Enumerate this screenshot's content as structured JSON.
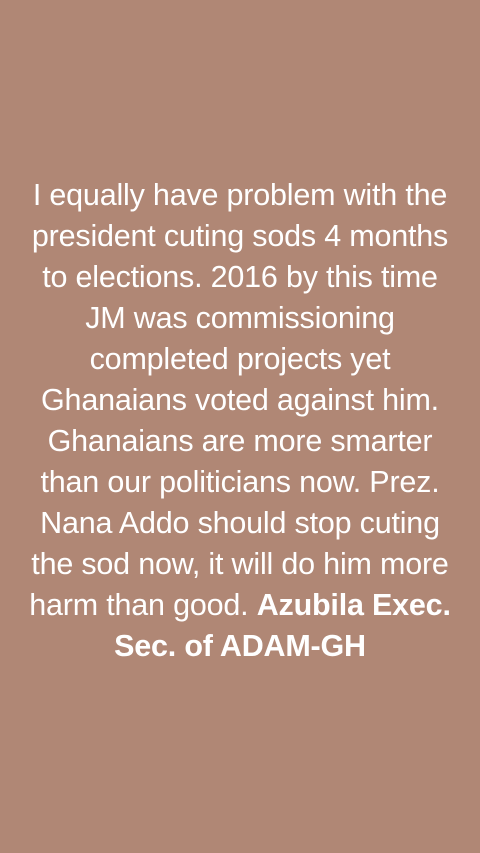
{
  "status": {
    "background_color": "#b08775",
    "text_color": "#ffffff",
    "body": "I equally have problem with the president cuting sods 4 months to elections. 2016 by this time JM was commissioning completed projects yet Ghanaians voted against him. Ghanaians are more smarter than our politicians now. Prez. Nana Addo should stop cuting the sod now, it will do him more harm than good.",
    "author": "Azubila Exec. Sec. of ADAM-GH"
  }
}
